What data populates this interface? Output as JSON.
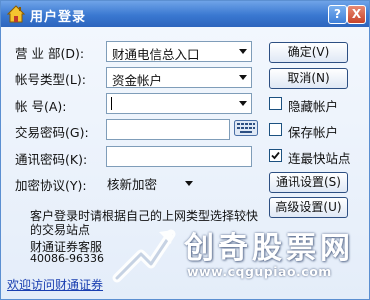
{
  "window": {
    "title": "用户登录",
    "help_label": "?",
    "close_label": "X"
  },
  "form": {
    "branch_label": "营 业 部(D):",
    "branch_value": "财通电信总入口",
    "account_type_label": "帐号类型(L):",
    "account_type_value": "资金帐户",
    "account_label": "帐     号(A):",
    "account_value": "",
    "trade_password_label": "交易密码(G):",
    "comm_password_label": "通讯密码(K):",
    "encryption_label": "加密协议(Y):",
    "encryption_value": "核新加密"
  },
  "buttons": {
    "ok": "确定(V)",
    "cancel": "取消(N)",
    "comm_settings": "通讯设置(S)",
    "advanced_settings": "高级设置(U)"
  },
  "checkboxes": {
    "hide_account": {
      "label": "隐藏帐户",
      "checked": false
    },
    "save_account": {
      "label": "保存帐户",
      "checked": false
    },
    "fastest_site": {
      "label": "连最快站点",
      "checked": true
    }
  },
  "info": {
    "notice": "客户登录时请根据自己的上网类型选择较快的交易站点",
    "company": "财通证券客服",
    "phone": "40086-96336"
  },
  "footer": {
    "link": "欢迎访问财通证券"
  },
  "watermark": {
    "title": "创奇股票网",
    "url": "www.cqgupiao.com"
  }
}
